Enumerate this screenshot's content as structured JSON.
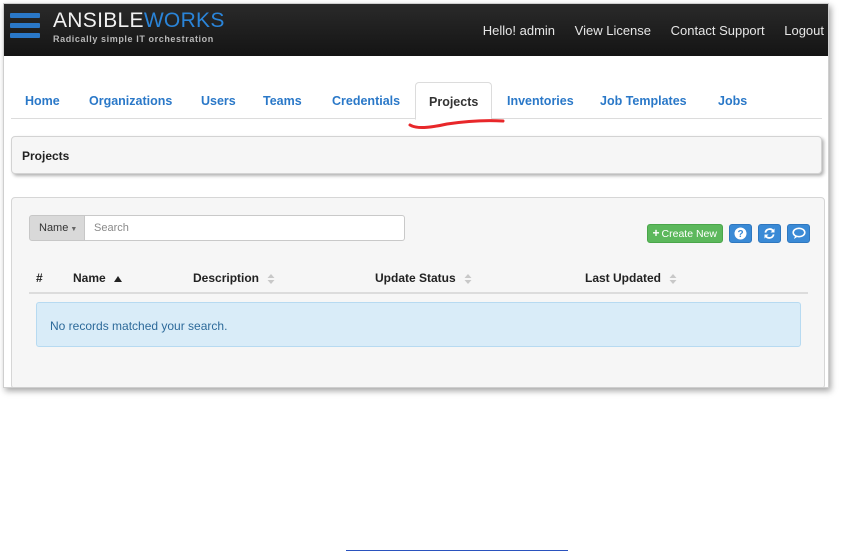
{
  "header": {
    "brand_main": "ANSIBLE",
    "brand_accent": "WORKS",
    "tagline": "Radically simple IT orchestration",
    "greeting": "Hello! admin",
    "links": [
      "View License",
      "Contact Support",
      "Logout"
    ]
  },
  "tabs": [
    {
      "label": "Home",
      "active": false
    },
    {
      "label": "Organizations",
      "active": false
    },
    {
      "label": "Users",
      "active": false
    },
    {
      "label": "Teams",
      "active": false
    },
    {
      "label": "Credentials",
      "active": false
    },
    {
      "label": "Projects",
      "active": true
    },
    {
      "label": "Inventories",
      "active": false
    },
    {
      "label": "Job Templates",
      "active": false
    },
    {
      "label": "Jobs",
      "active": false
    }
  ],
  "page": {
    "title": "Projects"
  },
  "search": {
    "field": "Name",
    "placeholder": "Search",
    "value": ""
  },
  "actions": {
    "create_label": "Create New",
    "icons": [
      "help-icon",
      "refresh-icon",
      "chat-icon"
    ]
  },
  "table": {
    "columns": [
      {
        "label": "#",
        "sort": "none"
      },
      {
        "label": "Name",
        "sort": "asc"
      },
      {
        "label": "Description",
        "sort": "both"
      },
      {
        "label": "Update Status",
        "sort": "both"
      },
      {
        "label": "Last Updated",
        "sort": "both"
      }
    ],
    "empty_message": "No records matched your search."
  },
  "colors": {
    "accent_blue": "#2a78c8",
    "header_bg": "#1f1f1f",
    "create_green": "#5cb85c",
    "annotation_red": "#e8272a",
    "empty_info_bg": "#d9ecf8"
  }
}
